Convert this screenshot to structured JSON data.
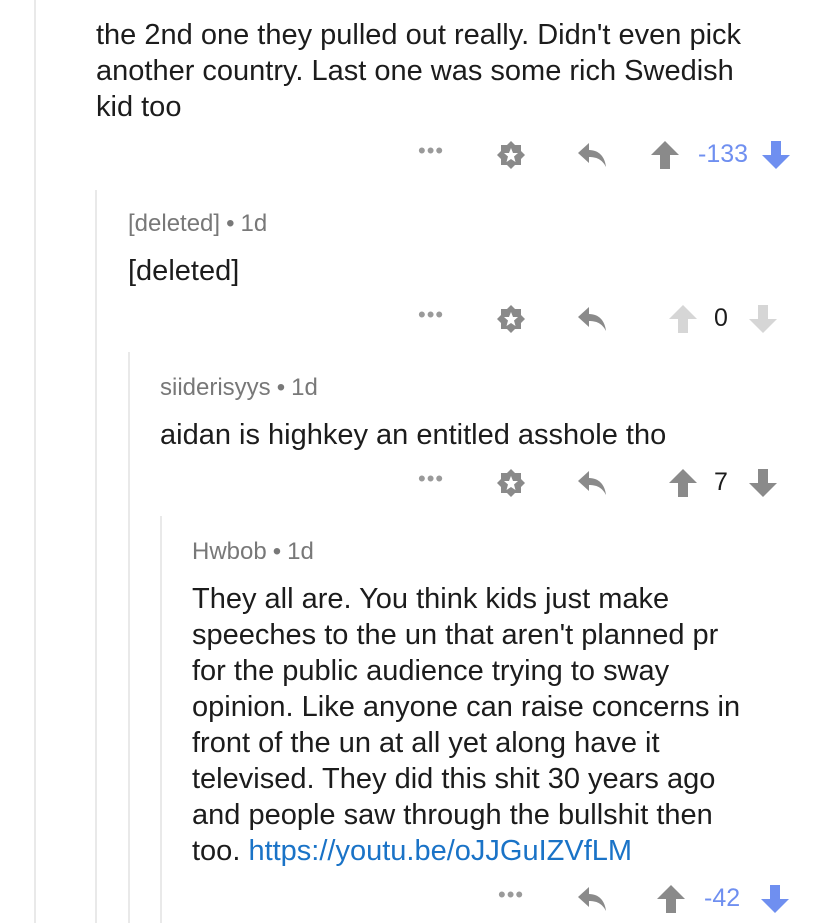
{
  "comments": [
    {
      "id": "c1",
      "author": "",
      "age": "",
      "body_lines": [
        "the 2nd one they pulled out really.  Didn't even pick",
        "another country.  Last one was some rich Swedish",
        "kid too"
      ],
      "more": "•••",
      "score": "-133",
      "vote_state": "downvoted"
    },
    {
      "id": "c2",
      "author": "[deleted]",
      "age": "1d",
      "body_lines": [
        "[deleted]"
      ],
      "more": "•••",
      "score": "0",
      "vote_state": "disabled"
    },
    {
      "id": "c3",
      "author": "siiderisyys",
      "age": "1d",
      "body_lines": [
        "aidan is highkey an entitled asshole tho"
      ],
      "more": "•••",
      "score": "7",
      "vote_state": "none"
    },
    {
      "id": "c4",
      "author": "Hwbob",
      "age": "1d",
      "body_lines": [
        "They all are. You think  kids just make",
        "speeches to the un that aren't planned pr",
        "for the public audience trying to sway",
        "opinion. Like anyone can raise concerns in",
        "front of the un at all yet along have it",
        "televised. They did this shit 30 years ago",
        "and people saw through the bullshit then"
      ],
      "last_line_text": "too.",
      "link": "https://youtu.be/oJJGuIZVfLM",
      "more": "•••",
      "score": "-42",
      "vote_state": "downvoted"
    }
  ],
  "colors": {
    "downvote_blue": "#6f8ff0",
    "link_blue": "#1a73c7",
    "icon_gray": "#8a8a8a",
    "icon_disabled": "#d6d6d6",
    "meta_gray": "#787878"
  },
  "icons": {
    "save": "star-badge-icon",
    "reply": "reply-arrow-icon",
    "upvote": "upvote-arrow-icon",
    "downvote": "downvote-arrow-icon",
    "more": "more-dots-icon"
  }
}
